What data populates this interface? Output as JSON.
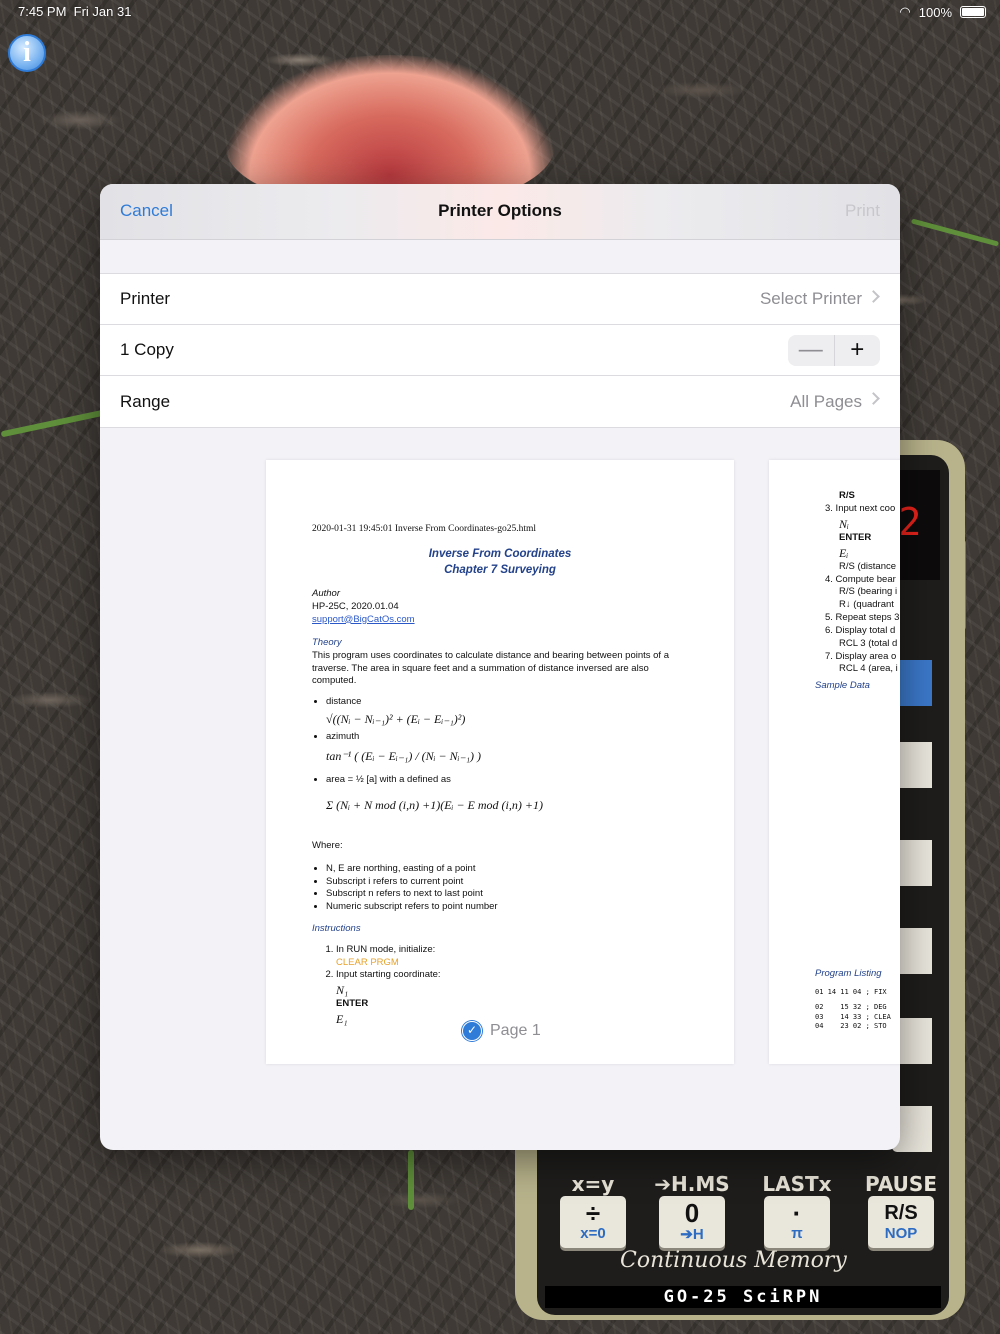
{
  "status_bar": {
    "time": "7:45 PM",
    "date": "Fri Jan 31",
    "battery": "100%"
  },
  "info_button": "i",
  "sheet": {
    "cancel": "Cancel",
    "title": "Printer Options",
    "print": "Print",
    "rows": {
      "printer": {
        "label": "Printer",
        "value": "Select Printer"
      },
      "copies": {
        "label": "1 Copy",
        "minus": "—",
        "plus": "+"
      },
      "range": {
        "label": "Range",
        "value": "All Pages"
      }
    }
  },
  "preview": {
    "page1": {
      "header": "2020-01-31 19:45:01 Inverse From Coordinates-go25.html",
      "title_line1": "Inverse From Coordinates",
      "title_line2": "Chapter 7 Surveying",
      "author_label": "Author",
      "author_value": "HP-25C, 2020.01.04",
      "author_email": "support@BigCatOs.com",
      "theory_label": "Theory",
      "theory_text": "This program uses coordinates to calculate distance and bearing between points of a traverse. The area in square feet and a summation of distance inversed are also computed.",
      "bullet_distance": "distance",
      "formula_distance": "√((Nᵢ − Nᵢ₋₁)² + (Eᵢ − Eᵢ₋₁)²)",
      "bullet_azimuth": "azimuth",
      "formula_azimuth": "tan⁻¹ ( (Eᵢ − Eᵢ₋₁) / (Nᵢ − Nᵢ₋₁) )",
      "bullet_area": "area = ½ [a] with a defined as",
      "formula_area": "Σ (Nᵢ + N mod (i,n) +1)(Eᵢ − E mod (i,n) +1)",
      "where_label": "Where:",
      "where_items": [
        "N, E are northing, easting of a point",
        "Subscript i refers to current point",
        "Subscript n refers to next to last point",
        "Numeric subscript refers to point number"
      ],
      "instructions_label": "Instructions",
      "step1_text": "In RUN mode, initialize:",
      "step1_code": "CLEAR PRGM",
      "step2_text": "Input starting coordinate:",
      "step2_n": "N₁",
      "step2_enter": "ENTER",
      "step2_e": "E₁",
      "page_label": "Page 1"
    },
    "page2": {
      "lines": [
        "R/S",
        "3. Input next coo",
        "Nᵢ",
        "ENTER",
        "Eᵢ",
        "R/S (distance",
        "4. Compute bear",
        "R/S (bearing i",
        "R↓ (quadrant",
        "5. Repeat steps 3",
        "6. Display total d",
        "RCL 3 (total d",
        "7. Display area o",
        "RCL 4 (area, i"
      ],
      "sample_data": "Sample Data",
      "program_listing": "Program Listing",
      "listing": [
        "01 14 11 04 ; FIX",
        "02    15 32 ; DEG",
        "03    14 33 ; CLEA",
        "04    23 02 ; STO"
      ]
    }
  },
  "calculator": {
    "display": "2",
    "labels": [
      "x=y",
      "➔H.MS",
      "LASTx",
      "PAUSE"
    ],
    "keys": [
      {
        "main": "÷",
        "sub": "x=0"
      },
      {
        "main": "0",
        "sub": "➔H"
      },
      {
        "main": "·",
        "sub": "π"
      },
      {
        "main": "R/S",
        "sub": "NOP"
      }
    ],
    "slogan": "Continuous Memory",
    "brand": "GO-25 SciRPN"
  },
  "colors": {
    "accent": "#2f7bd8",
    "link": "#2b58c9",
    "heading": "#23428a"
  }
}
